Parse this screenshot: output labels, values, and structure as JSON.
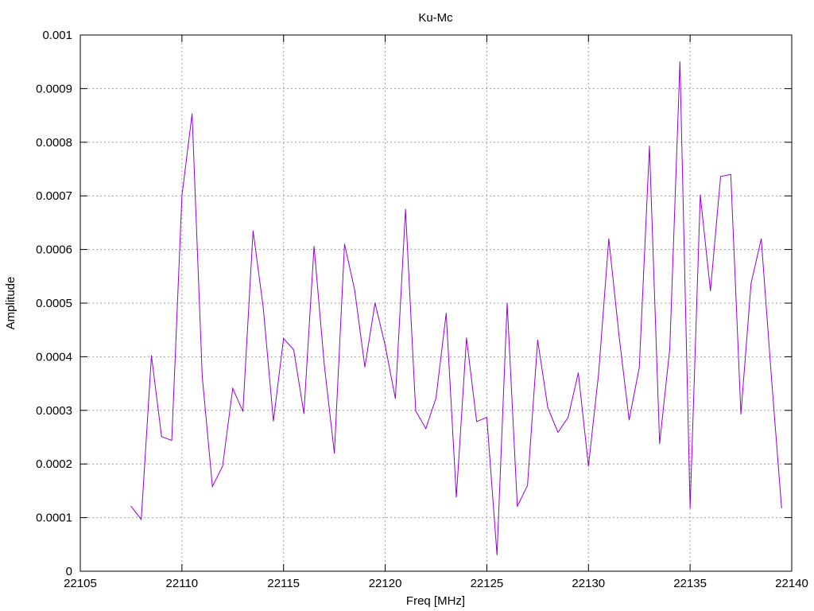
{
  "chart_data": {
    "type": "line",
    "title": "Ku-Mc",
    "xlabel": "Freq [MHz]",
    "ylabel": "Amplitude",
    "xlim": [
      22105,
      22140
    ],
    "ylim": [
      0,
      0.001
    ],
    "x_ticks": [
      "22105",
      "22110",
      "22115",
      "22120",
      "22125",
      "22130",
      "22135",
      "22140"
    ],
    "y_ticks": [
      "0",
      "0.0001",
      "0.0002",
      "0.0003",
      "0.0004",
      "0.0005",
      "0.0006",
      "0.0007",
      "0.0008",
      "0.0009",
      "0.001"
    ],
    "grid": true,
    "legend": "none",
    "line_color": "#9400d3",
    "x": [
      22107.5,
      22108.0,
      22108.5,
      22109.0,
      22109.5,
      22110.0,
      22110.5,
      22111.0,
      22111.5,
      22112.0,
      22112.5,
      22113.0,
      22113.5,
      22114.0,
      22114.5,
      22115.0,
      22115.5,
      22116.0,
      22116.5,
      22117.0,
      22117.5,
      22118.0,
      22118.5,
      22119.0,
      22119.5,
      22120.0,
      22120.5,
      22121.0,
      22121.5,
      22122.0,
      22122.5,
      22123.0,
      22123.5,
      22124.0,
      22124.5,
      22125.0,
      22125.5,
      22126.0,
      22126.5,
      22127.0,
      22127.5,
      22128.0,
      22128.5,
      22129.0,
      22129.5,
      22130.0,
      22130.5,
      22131.0,
      22131.5,
      22132.0,
      22132.5,
      22133.0,
      22133.5,
      22134.0,
      22134.5,
      22135.0,
      22135.5,
      22136.0,
      22136.5,
      22137.0,
      22137.5,
      22138.0,
      22138.5,
      22139.0,
      22139.5
    ],
    "values": [
      0.000121,
      9.65e-05,
      0.000402,
      0.000251,
      0.000244,
      0.0007,
      0.000853,
      0.000363,
      0.000158,
      0.000196,
      0.000341,
      0.000298,
      0.000635,
      0.000492,
      0.00028,
      0.000434,
      0.000413,
      0.000294,
      0.000606,
      0.000386,
      0.00022,
      0.00061,
      0.000524,
      0.000381,
      0.0005,
      0.000421,
      0.000322,
      0.000675,
      0.000299,
      0.000266,
      0.000323,
      0.000481,
      0.000138,
      0.000435,
      0.000279,
      0.000287,
      3.05e-05,
      0.0005,
      0.000121,
      0.00016,
      0.000431,
      0.000305,
      0.000259,
      0.000287,
      0.00037,
      0.000196,
      0.000369,
      0.00062,
      0.000441,
      0.000282,
      0.00038,
      0.000793,
      0.000238,
      0.000415,
      0.00095,
      0.000118,
      0.000702,
      0.000523,
      0.000736,
      0.00074,
      0.000293,
      0.000537,
      0.00062,
      0.000362,
      0.000118
    ]
  }
}
